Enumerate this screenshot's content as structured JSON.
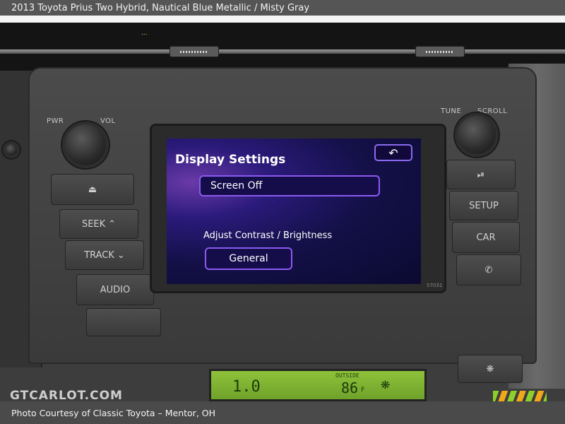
{
  "caption_top": "2013 Toyota Prius Two Hybrid,  Nautical Blue Metallic / Misty Gray",
  "caption_bottom": "Photo Courtesy of Classic Toyota – Mentor, OH",
  "watermark": "GTCARLOT.COM",
  "dash": {
    "pwr_label": "PWR",
    "vol_label": "VOL",
    "tune_label": "TUNE",
    "scroll_label": "SCROLL",
    "eject_icon": "eject-icon",
    "seek_label": "SEEK",
    "track_label": "TRACK",
    "audio_label": "AUDIO",
    "play_pause_icon": "play-pause-icon",
    "setup_label": "SETUP",
    "car_label": "CAR",
    "phone_icon": "phone-icon",
    "model_code": "57031"
  },
  "screen": {
    "title": "Display Settings",
    "back_icon": "back-arrow-icon",
    "screen_off_label": "Screen Off",
    "adjust_label": "Adjust Contrast / Brightness",
    "general_label": "General"
  },
  "climate": {
    "temp": "1.0",
    "outside_label": "OUTSIDE",
    "outside_temp": "86",
    "unit": "F"
  },
  "colors": {
    "screen_accent": "#8a5af0",
    "lcd_green": "#8fc23a"
  }
}
